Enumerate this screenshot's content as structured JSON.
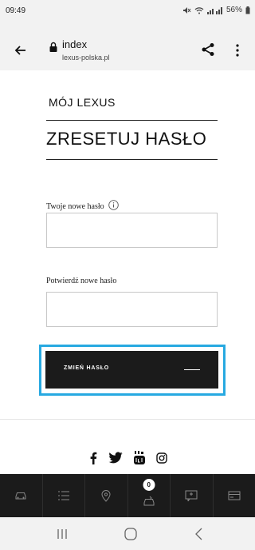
{
  "status_bar": {
    "time": "09:49",
    "battery": "56%"
  },
  "browser": {
    "page_title": "index",
    "domain": "lexus-polska.pl"
  },
  "page": {
    "brand": "MÓJ LEXUS",
    "title": "ZRESETUJ HASŁO",
    "new_password_label": "Twoje nowe hasło",
    "new_password_value": "",
    "confirm_password_label": "Potwierdź nowe hasło",
    "confirm_password_value": "",
    "submit_label": "ZMIEŃ HASŁO"
  },
  "social": [
    "facebook-icon",
    "twitter-icon",
    "youtube-icon",
    "instagram-icon"
  ],
  "app_nav": {
    "items": [
      "car-icon",
      "list-icon",
      "location-pin-icon",
      "service-car-icon",
      "chat-icon",
      "card-icon"
    ],
    "badge_count": "0"
  },
  "colors": {
    "highlight": "#27a9e1",
    "button": "#1b1b1b",
    "nav_bg": "#1b1b1b"
  }
}
